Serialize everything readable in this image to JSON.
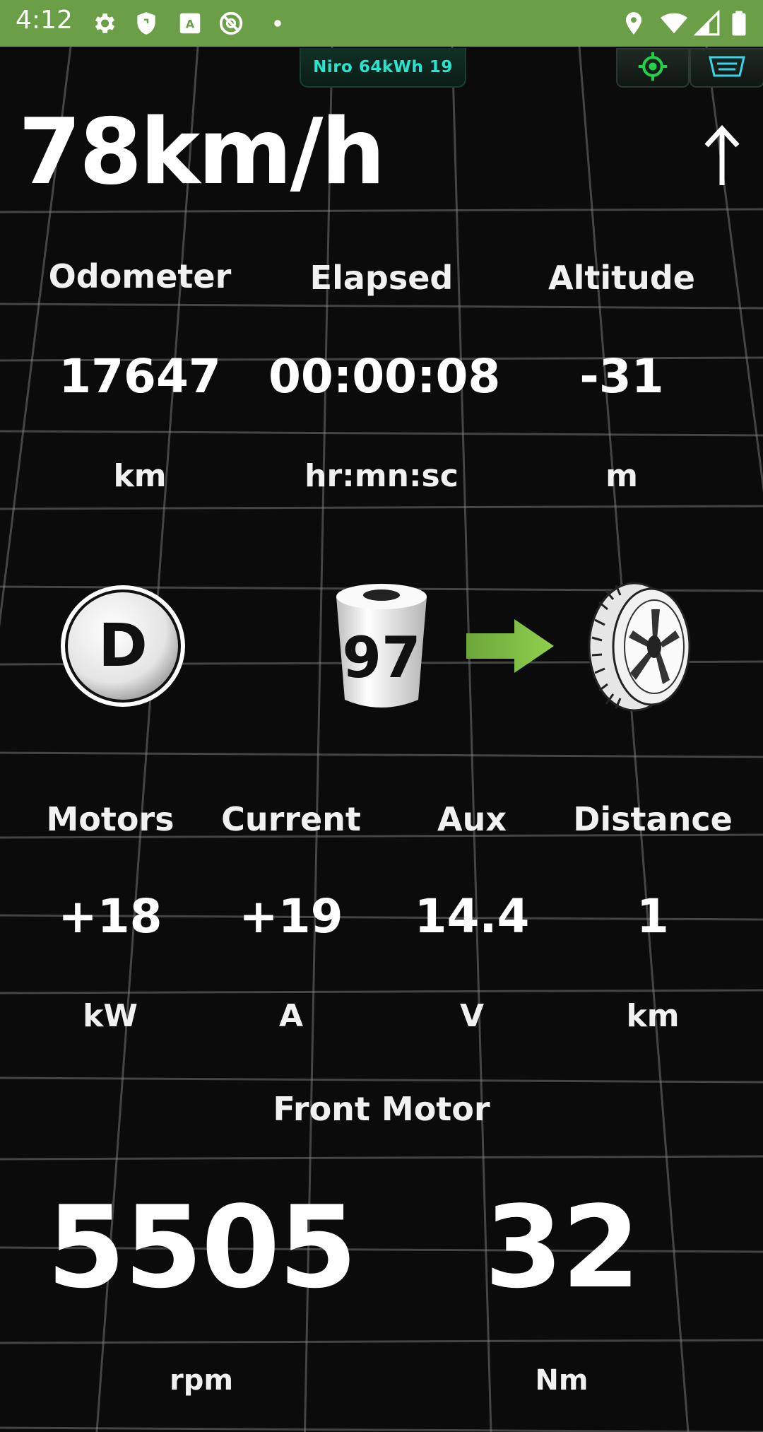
{
  "status_bar": {
    "time": "4:12",
    "icons_left": [
      "settings-icon",
      "shield-icon",
      "app-icon",
      "no-route-icon",
      "dot-icon"
    ],
    "icons_right": [
      "location-icon",
      "wifi-icon",
      "signal-icon",
      "battery-icon"
    ]
  },
  "header": {
    "vehicle_label": "Niro 64kWh 19",
    "buttons": [
      "gps-target-icon",
      "obd-connector-icon"
    ]
  },
  "speed": {
    "value": "78km/h",
    "heading_icon": "up-arrow-icon"
  },
  "stats_top": {
    "labels": [
      "Odometer",
      "Elapsed",
      "Altitude"
    ],
    "values": [
      "17647",
      "00:00:08",
      "-31"
    ],
    "units": [
      "km",
      "hr:mn:sc",
      "m"
    ]
  },
  "drive": {
    "gear": "D",
    "battery_percent": "97",
    "flow_icon": "power-flow-arrow-icon",
    "wheel_icon": "tire-icon"
  },
  "stats_bottom": {
    "labels": [
      "Motors",
      "Current",
      "Aux",
      "Distance"
    ],
    "values": [
      "+18",
      "+19",
      "14.4",
      "1"
    ],
    "units": [
      "kW",
      "A",
      "V",
      "km"
    ]
  },
  "front_motor": {
    "title": "Front Motor",
    "rpm_value": "5505",
    "rpm_unit": "rpm",
    "torque_value": "32",
    "torque_unit": "Nm"
  },
  "colors": {
    "status_bar": "#6a9e47",
    "pill_text": "#27e3d0",
    "gps_green": "#25d04a",
    "arrow_green": "#7cc242"
  }
}
